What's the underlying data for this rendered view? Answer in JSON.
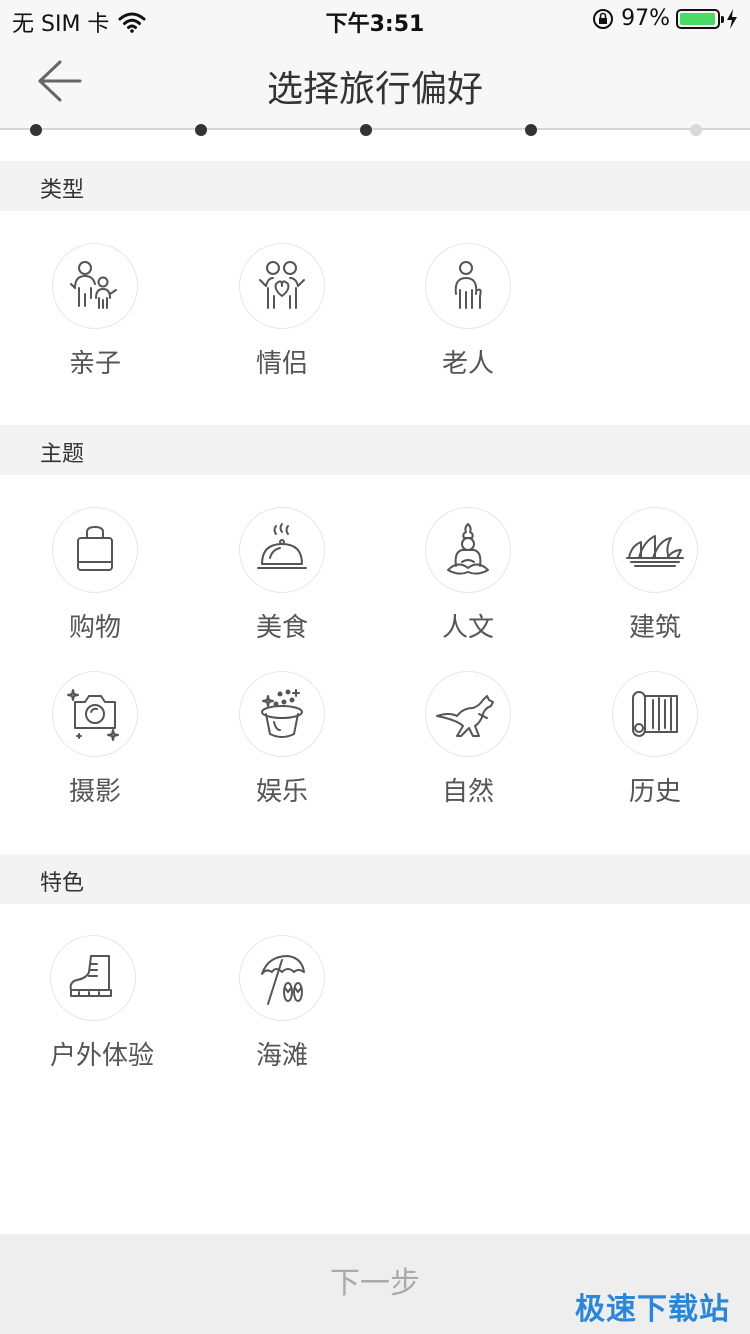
{
  "status_bar": {
    "carrier": "无 SIM 卡",
    "time": "下午3:51",
    "battery_percent": "97%",
    "battery_level": 0.97
  },
  "nav": {
    "title": "选择旅行偏好"
  },
  "progress": {
    "total_steps": 5,
    "completed_steps": 4
  },
  "sections": {
    "type": {
      "title": "类型",
      "items": [
        {
          "label": "亲子",
          "icon": "parent-child-icon"
        },
        {
          "label": "情侣",
          "icon": "couple-icon"
        },
        {
          "label": "老人",
          "icon": "elderly-icon"
        }
      ]
    },
    "theme": {
      "title": "主题",
      "items": [
        {
          "label": "购物",
          "icon": "shopping-bag-icon"
        },
        {
          "label": "美食",
          "icon": "food-cloche-icon"
        },
        {
          "label": "人文",
          "icon": "buddha-icon"
        },
        {
          "label": "建筑",
          "icon": "opera-house-icon"
        },
        {
          "label": "摄影",
          "icon": "camera-icon"
        },
        {
          "label": "娱乐",
          "icon": "magic-hat-icon"
        },
        {
          "label": "自然",
          "icon": "kangaroo-icon"
        },
        {
          "label": "历史",
          "icon": "scroll-icon"
        }
      ]
    },
    "feature": {
      "title": "特色",
      "items": [
        {
          "label": "户外体验",
          "icon": "hiking-boot-icon"
        },
        {
          "label": "海滩",
          "icon": "beach-umbrella-icon"
        }
      ]
    }
  },
  "footer": {
    "next_label": "下一步"
  },
  "watermark": {
    "text": "极速下载站"
  },
  "colors": {
    "icon_stroke": "#555555",
    "watermark": "#2a87d8",
    "battery_fill": "#4cd964"
  }
}
